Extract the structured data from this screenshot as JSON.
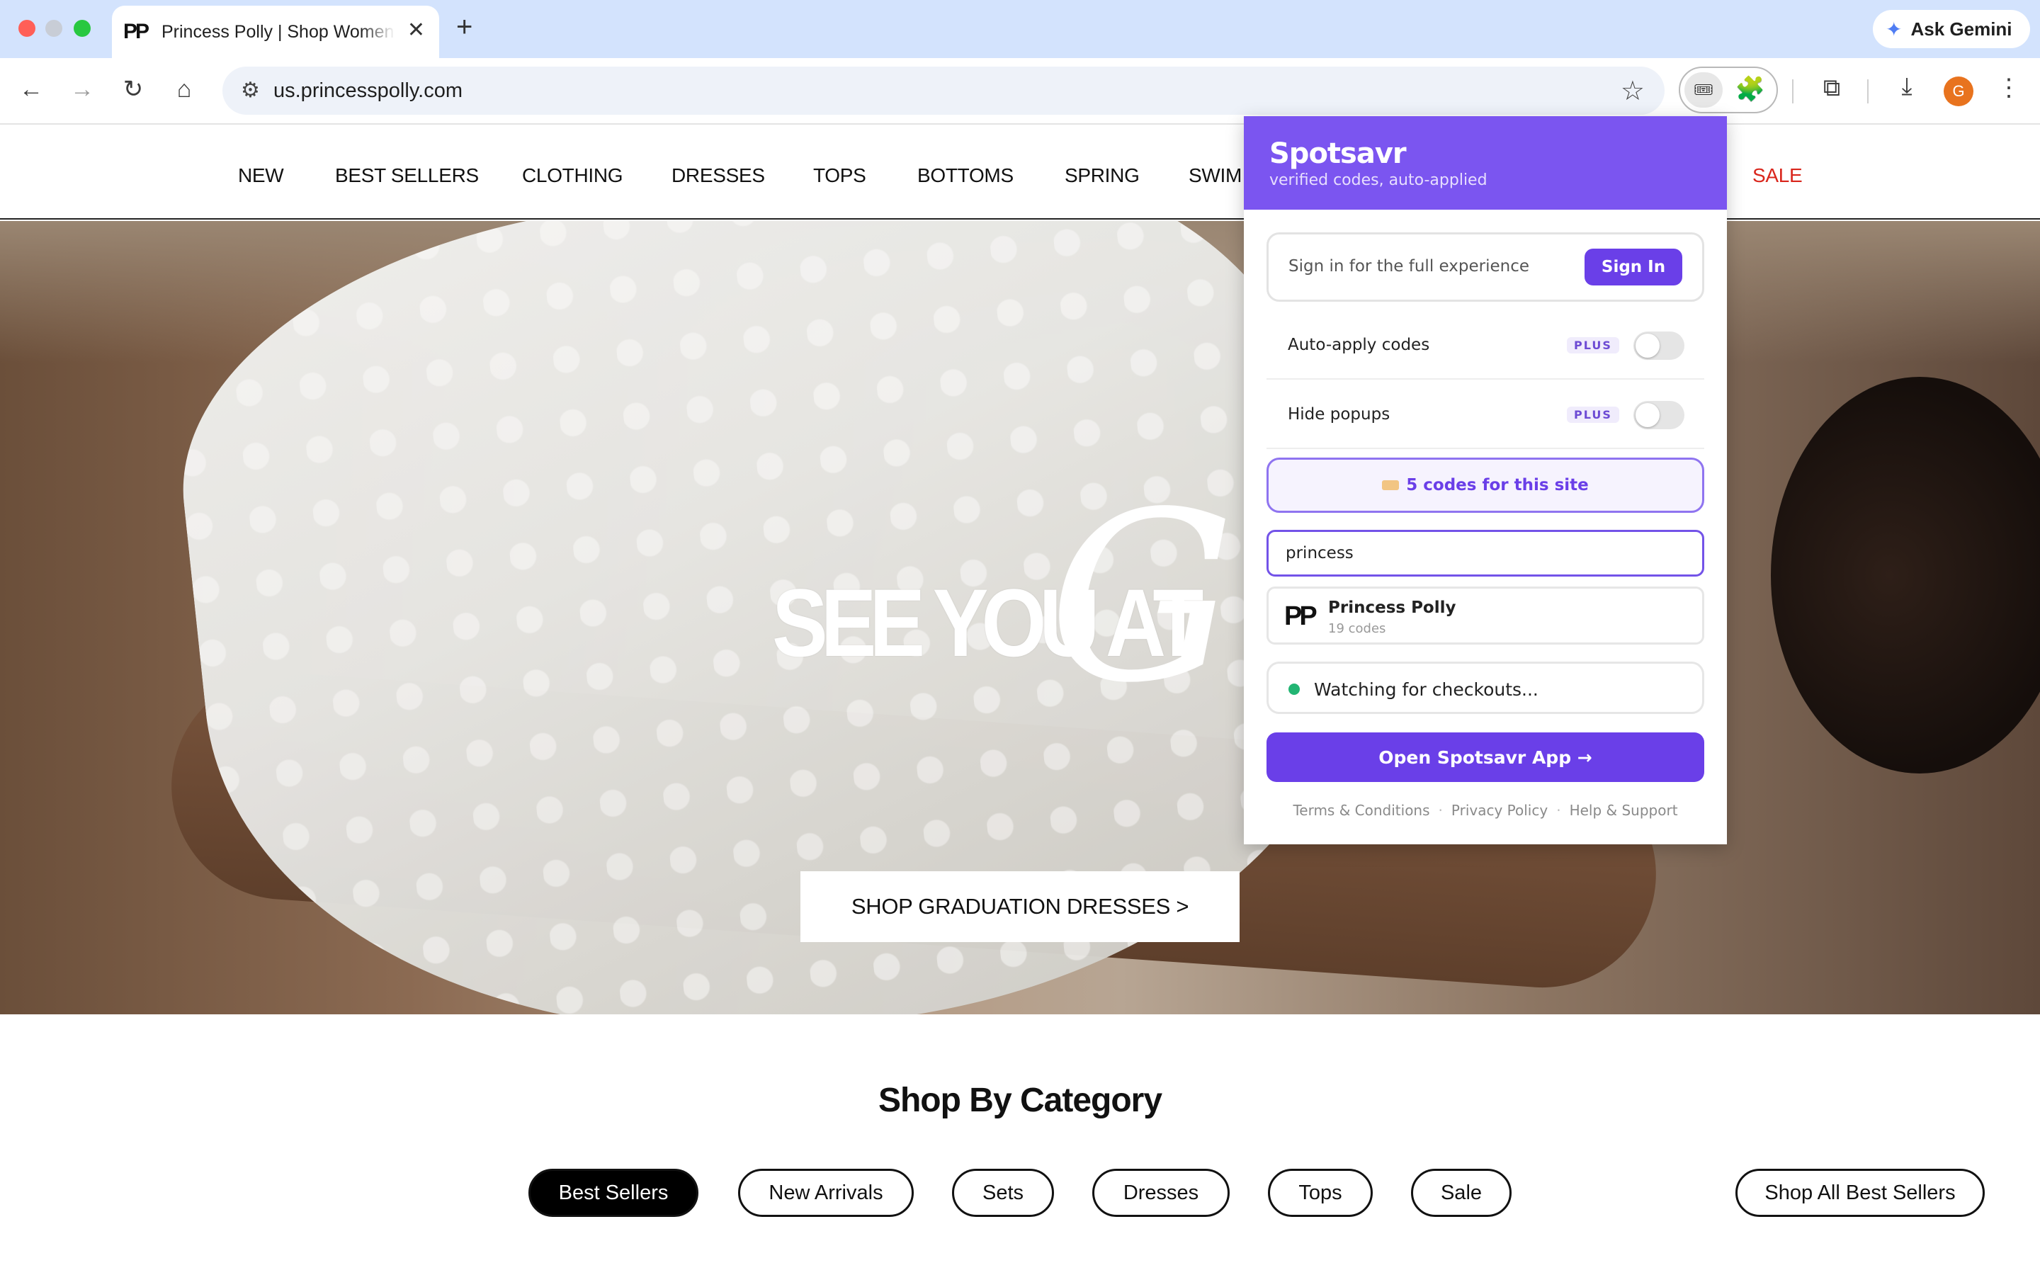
{
  "browser": {
    "tab_title": "Princess Polly | Shop Women's",
    "tab_favicon": "PP",
    "tab_close": "✕",
    "new_tab": "+",
    "gemini_label": "Ask Gemini",
    "url": "us.princesspolly.com",
    "icons": {
      "back": "←",
      "forward": "→",
      "reload": "↻",
      "home": "⌂",
      "site_settings": "⚙",
      "bookmark": "☆",
      "spotsavr_ext": "🎟",
      "extensions": "🧩",
      "tab_search": "⧉",
      "download": "⤓",
      "menu": "⋮"
    },
    "avatar_letter": "G"
  },
  "site_nav": {
    "items": [
      "NEW",
      "BEST SELLERS",
      "CLOTHING",
      "DRESSES",
      "TOPS",
      "BOTTOMS",
      "SPRING",
      "SWIM"
    ],
    "sale": "SALE"
  },
  "hero": {
    "tagline": "SEE YOU AT",
    "script": "Gra",
    "cta": "SHOP GRADUATION DRESSES >"
  },
  "category": {
    "title": "Shop By Category",
    "pills": [
      "Best Sellers",
      "New Arrivals",
      "Sets",
      "Dresses",
      "Tops",
      "Sale"
    ],
    "active_pill": "Best Sellers",
    "shop_all": "Shop All Best Sellers"
  },
  "spotsavr": {
    "brand": "Spotsavr",
    "subtitle": "verified codes, auto-applied",
    "signin_text": "Sign in for the full experience",
    "signin_button": "Sign In",
    "settings": [
      {
        "label": "Auto-apply codes",
        "badge": "PLUS",
        "enabled": false
      },
      {
        "label": "Hide popups",
        "badge": "PLUS",
        "enabled": false
      }
    ],
    "codes_text": "5 codes for this site",
    "search_value": "princess",
    "result": {
      "logo": "PP",
      "name": "Princess Polly",
      "count": "19 codes"
    },
    "watch_text": "Watching for checkouts...",
    "open_app": "Open Spotsavr App →",
    "footer": {
      "terms": "Terms & Conditions",
      "privacy": "Privacy Policy",
      "help": "Help & Support",
      "separator": "·"
    },
    "colors": {
      "accent": "#7b55f0",
      "button": "#6a3fe8",
      "status": "#22b573"
    }
  }
}
